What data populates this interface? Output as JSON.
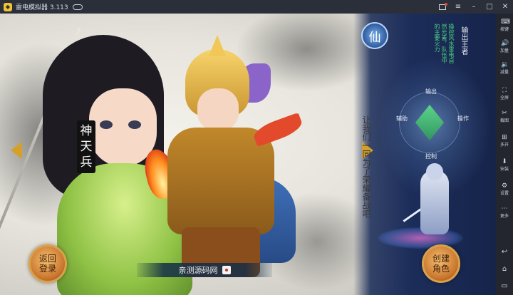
{
  "titlebar": {
    "app_title": "雷电模拟器 3.113",
    "logo_glyph": "◆"
  },
  "game": {
    "hero_name": "神天兵",
    "poem": "让我们一同为了荣耀备战吧",
    "class_badge": "仙",
    "role_title": "输出王者",
    "role_desc": "操控风水雷电自然元素，队伍中的主要火力",
    "radar": {
      "top": "输出",
      "left": "辅助",
      "right": "操作",
      "bottom": "控制"
    },
    "back_button": "返回登录",
    "create_button": "创建角色",
    "watermark": "亲测源码网"
  },
  "sidebar": {
    "items": [
      {
        "icon": "keyboard-icon",
        "glyph": "⌨",
        "label": "按键"
      },
      {
        "icon": "volume-up-icon",
        "glyph": "🔊",
        "label": "加量"
      },
      {
        "icon": "volume-down-icon",
        "glyph": "🔉",
        "label": "减量"
      },
      {
        "icon": "fullscreen-icon",
        "glyph": "⛶",
        "label": "全屏"
      },
      {
        "icon": "scissors-icon",
        "glyph": "✂",
        "label": "截图"
      },
      {
        "icon": "multi-open-icon",
        "glyph": "⊞",
        "label": "多开"
      },
      {
        "icon": "install-icon",
        "glyph": "⬇",
        "label": "安装"
      },
      {
        "icon": "settings-icon",
        "glyph": "⚙",
        "label": "设置"
      },
      {
        "icon": "more-icon",
        "glyph": "⋯",
        "label": "更多"
      }
    ],
    "nav": [
      {
        "icon": "back-icon",
        "glyph": "↩"
      },
      {
        "icon": "home-icon",
        "glyph": "⌂"
      },
      {
        "icon": "recent-apps-icon",
        "glyph": "▭"
      }
    ]
  },
  "colors": {
    "titlebar": "#2b2f3a",
    "accent_gold": "#d4a02a",
    "panel_blue": "#1c2d5a",
    "role_desc_green": "#4bd07f"
  }
}
